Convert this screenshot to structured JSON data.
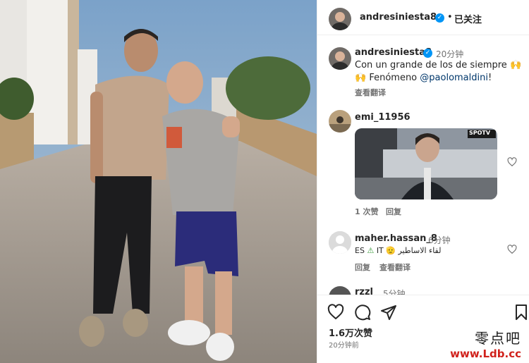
{
  "header": {
    "username": "andresiniesta8",
    "follow_status": "已关注",
    "more_icon": "more-horizontal-icon"
  },
  "caption": {
    "username": "andresiniesta8",
    "time": "20分钟",
    "line1": "Con un grande de los de siempre",
    "line2_prefix": "Fenómeno ",
    "mention": "@paolomaldini",
    "line2_suffix": "!",
    "translate": "查看翻译"
  },
  "comments": [
    {
      "username": "emi_11956",
      "video_badge": "SPOTV",
      "likes": "1 次赞",
      "reply": "回复"
    },
    {
      "username": "maher.hassan_8",
      "time": "6分钟",
      "text_prefix": "ES",
      "text_middle": "IT",
      "text_arabic": "لقاء الاساطير",
      "reply": "回复",
      "translate": "查看翻译"
    },
    {
      "username": "rzzl",
      "time": "5分钟"
    }
  ],
  "footer": {
    "likes": "1.6万次赞",
    "time": "20分钟前"
  },
  "watermark": {
    "line1": "零点吧",
    "line2": "www.Ldb.cc"
  },
  "colors": {
    "verified": "#0095f6",
    "mention": "#00376b",
    "watermark_url": "#d0211b"
  }
}
